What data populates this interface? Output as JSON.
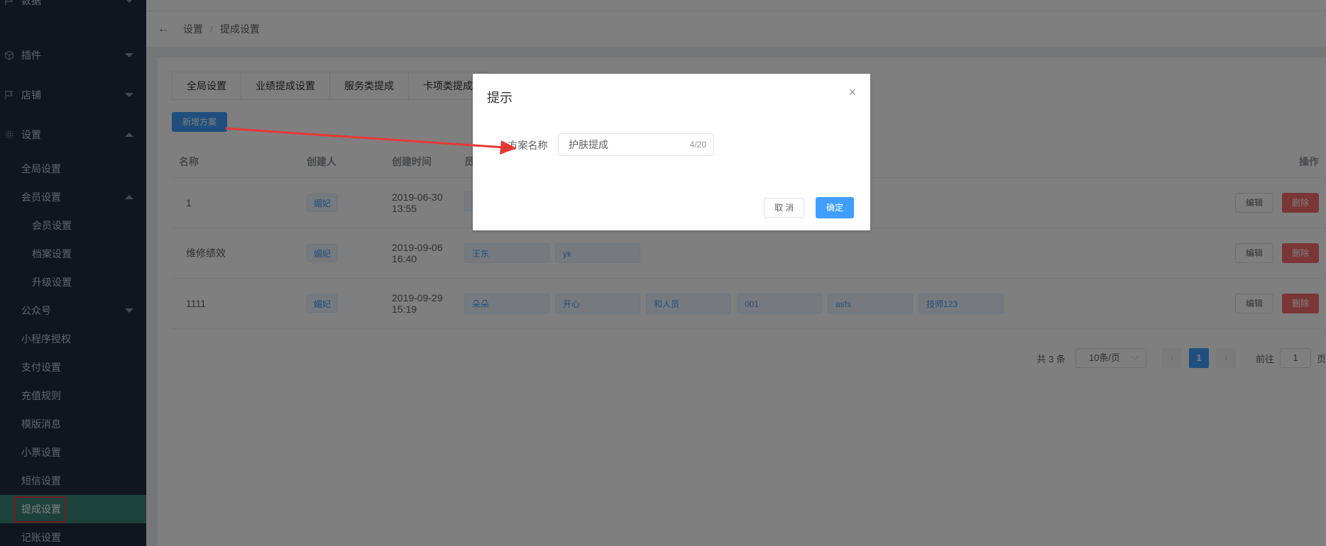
{
  "sidebar": {
    "top_items": [
      {
        "label": "数据",
        "icon": "flag-icon"
      },
      {
        "label": "插件",
        "icon": "cube-icon"
      },
      {
        "label": "店铺",
        "icon": "flag-icon"
      },
      {
        "label": "设置",
        "icon": "gear-icon"
      }
    ],
    "sub_items": [
      {
        "label": "全局设置"
      },
      {
        "label": "会员设置"
      },
      {
        "label": "会员设置"
      },
      {
        "label": "档案设置"
      },
      {
        "label": "升级设置"
      },
      {
        "label": "公众号"
      },
      {
        "label": "小程序授权"
      },
      {
        "label": "支付设置"
      },
      {
        "label": "充值规则"
      },
      {
        "label": "模版消息"
      },
      {
        "label": "小票设置"
      },
      {
        "label": "短信设置"
      },
      {
        "label": "提成设置"
      },
      {
        "label": "记账设置"
      }
    ]
  },
  "breadcrumb": {
    "back": "←",
    "parent": "设置",
    "separator": "/",
    "current": "提成设置"
  },
  "tabs": [
    "全局设置",
    "业绩提成设置",
    "服务类提成",
    "卡项类提成"
  ],
  "add_button": "新增方案",
  "table": {
    "headers": {
      "name": "名称",
      "creator": "创建人",
      "created": "创建时间",
      "staff": "员",
      "ops": "操作"
    },
    "rows": [
      {
        "name": "1",
        "creator": "媚妃",
        "date": "2019-06-30",
        "time": "13:55",
        "staff": [
          ""
        ]
      },
      {
        "name": "维修绩效",
        "creator": "媚妃",
        "date": "2019-09-06",
        "time": "16:40",
        "staff": [
          "王东",
          "yk"
        ]
      },
      {
        "name": "1111",
        "creator": "媚妃",
        "date": "2019-09-29",
        "time": "15:19",
        "staff": [
          "朵朵",
          "开心",
          "和人员",
          "001",
          "asfs",
          "技师123"
        ]
      }
    ],
    "edit_label": "编辑",
    "delete_label": "删除"
  },
  "pager": {
    "total": "共 3 条",
    "size": "10条/页",
    "prev": "‹",
    "page": "1",
    "next": "›",
    "goto": "前往",
    "goto_value": "1",
    "unit": "页"
  },
  "dialog": {
    "title": "提示",
    "close": "×",
    "required_mark": "*",
    "label": "方案名称",
    "value": "护肤提成",
    "count": "4/20",
    "cancel": "取 消",
    "ok": "确定"
  },
  "colors": {
    "primary": "#409eff",
    "danger": "#f56c6c",
    "sidebar": "#1f2d3d",
    "active": "#3a8376",
    "annotation": "#e53935"
  }
}
